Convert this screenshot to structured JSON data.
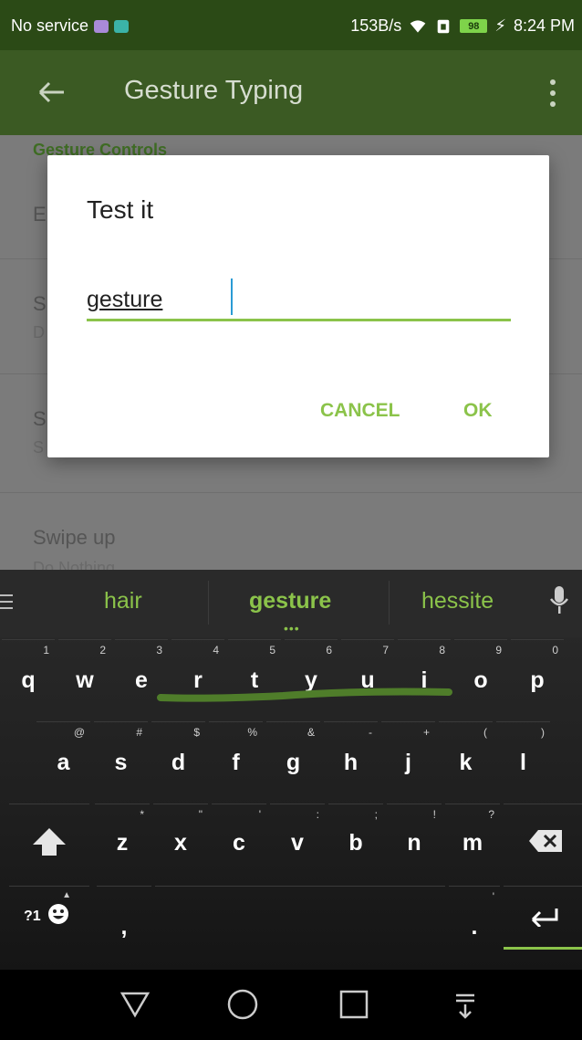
{
  "status_bar": {
    "left_text": "No service",
    "speed": "153B/s",
    "battery": "98",
    "time": "8:24 PM"
  },
  "app_bar": {
    "title": "Gesture Typing",
    "back_icon": "arrow-left-icon",
    "more_icon": "more-vert-icon"
  },
  "settings": {
    "section_header": "Gesture Controls",
    "rows": [
      {
        "title": "E",
        "summary": ""
      },
      {
        "title": "S",
        "summary": "D"
      },
      {
        "title": "S",
        "summary": "S"
      },
      {
        "title": "Swipe up",
        "summary": "Do Nothing"
      }
    ]
  },
  "dialog": {
    "title": "Test it",
    "input_value": "gesture",
    "cancel_label": "CANCEL",
    "ok_label": "OK"
  },
  "keyboard": {
    "suggestions": [
      "hair",
      "gesture",
      "hessite"
    ],
    "more_indicator": "•••",
    "rows": [
      [
        {
          "key": "q",
          "hint": "1"
        },
        {
          "key": "w",
          "hint": "2"
        },
        {
          "key": "e",
          "hint": "3"
        },
        {
          "key": "r",
          "hint": "4"
        },
        {
          "key": "t",
          "hint": "5"
        },
        {
          "key": "y",
          "hint": "6"
        },
        {
          "key": "u",
          "hint": "7"
        },
        {
          "key": "i",
          "hint": "8"
        },
        {
          "key": "o",
          "hint": "9"
        },
        {
          "key": "p",
          "hint": "0"
        }
      ],
      [
        {
          "key": "a",
          "hint": "@"
        },
        {
          "key": "s",
          "hint": "#"
        },
        {
          "key": "d",
          "hint": "$"
        },
        {
          "key": "f",
          "hint": "%"
        },
        {
          "key": "g",
          "hint": "&"
        },
        {
          "key": "h",
          "hint": "-"
        },
        {
          "key": "j",
          "hint": "+"
        },
        {
          "key": "k",
          "hint": "("
        },
        {
          "key": "l",
          "hint": ")"
        }
      ],
      [
        {
          "key": "z",
          "hint": "*"
        },
        {
          "key": "x",
          "hint": "\""
        },
        {
          "key": "c",
          "hint": "'"
        },
        {
          "key": "v",
          "hint": ":"
        },
        {
          "key": "b",
          "hint": ";"
        },
        {
          "key": "n",
          "hint": "!"
        },
        {
          "key": "m",
          "hint": "?"
        }
      ]
    ],
    "symbols_label": "?1",
    "comma": ",",
    "period": ".",
    "period_hint": "'",
    "shift_icon": "shift-arrow-icon",
    "delete_icon": "backspace-icon",
    "enter_icon": "enter-arrow-icon",
    "emoji_icon": "smiley-icon",
    "mic_icon": "microphone-icon",
    "menu_icon": "hamburger-icon"
  },
  "navbar": {
    "icons": [
      "back-triangle-icon",
      "home-circle-icon",
      "recents-square-icon",
      "hide-keyboard-icon"
    ]
  },
  "colors": {
    "accent": "#8bc34a",
    "appbar": "#3b5a23",
    "statusbar": "#2b4a16"
  }
}
